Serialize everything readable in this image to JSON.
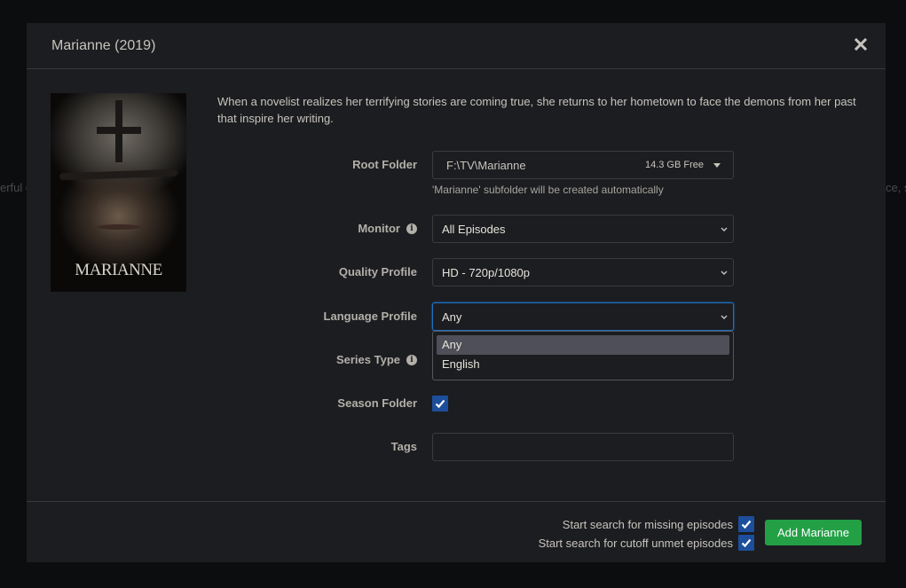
{
  "background": {
    "left_fragment": "erful c",
    "right_fragment": "ce, sa"
  },
  "modal": {
    "title": "Marianne (2019)",
    "close_icon": "close-icon"
  },
  "poster": {
    "title_text": "MARIANNE"
  },
  "overview": "When a novelist realizes her terrifying stories are coming true, she returns to her hometown to face the demons from her past that inspire her writing.",
  "form": {
    "root_folder": {
      "label": "Root Folder",
      "value": "F:\\TV\\Marianne",
      "free_space": "14.3 GB Free",
      "help": "'Marianne' subfolder will be created automatically"
    },
    "monitor": {
      "label": "Monitor",
      "value": "All Episodes",
      "info_icon": "info-icon"
    },
    "quality_profile": {
      "label": "Quality Profile",
      "value": "HD - 720p/1080p"
    },
    "language_profile": {
      "label": "Language Profile",
      "value": "Any",
      "options": [
        "Any",
        "English"
      ],
      "highlighted_option": "Any"
    },
    "series_type": {
      "label": "Series Type",
      "info_icon": "info-icon"
    },
    "season_folder": {
      "label": "Season Folder",
      "checked": true
    },
    "tags": {
      "label": "Tags",
      "value": ""
    }
  },
  "footer": {
    "search_missing_label": "Start search for missing episodes",
    "search_missing_checked": true,
    "search_cutoff_label": "Start search for cutoff unmet episodes",
    "search_cutoff_checked": true,
    "add_button_label": "Add Marianne"
  },
  "colors": {
    "accent_blue": "#1d4e9b",
    "focus_blue": "#1f72c4",
    "success_green": "#23a046"
  }
}
